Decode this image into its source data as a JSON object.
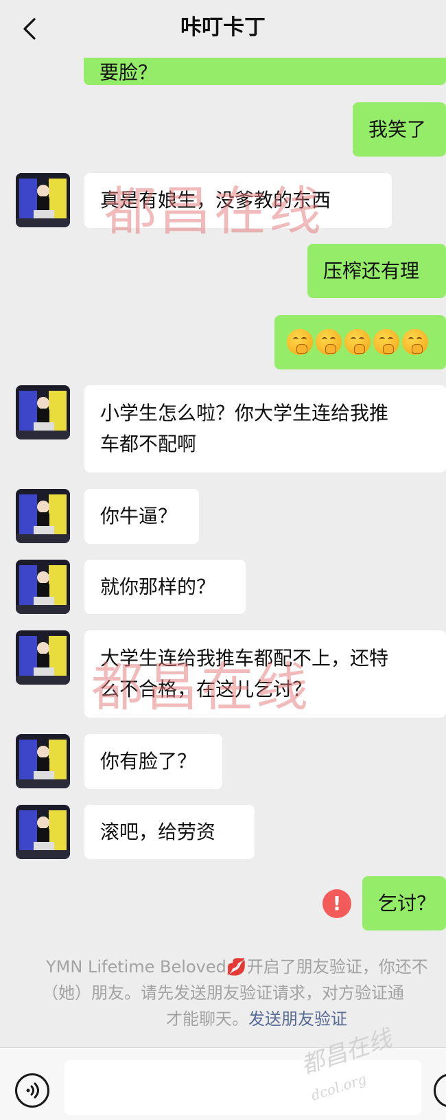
{
  "header": {
    "title": "咔叮卡丁"
  },
  "messages": [
    {
      "side": "me",
      "text": "要脸？"
    },
    {
      "side": "me",
      "text": "我笑了"
    },
    {
      "side": "other",
      "text": "真是有娘生，没爹教的东西"
    },
    {
      "side": "me",
      "text": "压榨还有理"
    },
    {
      "side": "me",
      "emoji_count": 5,
      "emoji": "smirk-face"
    },
    {
      "side": "other",
      "lines": [
        "小学生怎么啦？你大学生连给我推",
        "车都不配啊"
      ]
    },
    {
      "side": "other",
      "text": "你牛逼？"
    },
    {
      "side": "other",
      "text": "就你那样的？"
    },
    {
      "side": "other",
      "lines": [
        "大学生连给我推车都配不上，还特",
        "么不合格，在这儿乞讨？"
      ]
    },
    {
      "side": "other",
      "text": "你有脸了？"
    },
    {
      "side": "other",
      "text": "滚吧，给劳资"
    },
    {
      "side": "me",
      "text": "乞讨？",
      "status": "failed"
    }
  ],
  "system_notice": {
    "line1": "YMN Lifetime Beloved💋开启了朋友验证，你还不",
    "line2": "（她）朋友。请先发送朋友验证请求，对方验证通",
    "line3_text": "才能聊天。",
    "line3_link": "发送朋友验证"
  },
  "watermarks": [
    "都昌在线",
    "都昌在线",
    "都昌在线",
    "dcol.org"
  ],
  "icons": {
    "back": "chevron-left-icon",
    "voice": "voice-icon",
    "emoji": "emoji-icon",
    "warning": "exclamation-icon"
  },
  "colors": {
    "background": "#ededed",
    "my_bubble": "#95ec69",
    "other_bubble": "#ffffff",
    "warning": "#f35b5b",
    "link": "#576b95"
  }
}
